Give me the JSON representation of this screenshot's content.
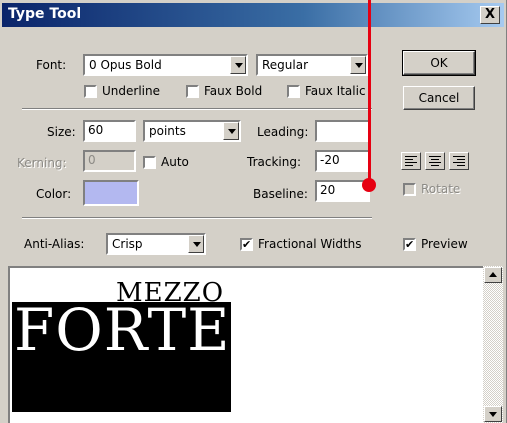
{
  "window": {
    "title": "Type Tool",
    "close_glyph": "X"
  },
  "font": {
    "label": "Font:",
    "family_value": "0 Opus Bold",
    "style_value": "Regular",
    "underline_label": "Underline",
    "underline_checked": false,
    "faux_bold_label": "Faux Bold",
    "faux_bold_checked": false,
    "faux_italic_label": "Faux Italic",
    "faux_italic_checked": false
  },
  "buttons": {
    "ok_label": "OK",
    "cancel_label": "Cancel"
  },
  "metrics": {
    "size_label": "Size:",
    "size_value": "60",
    "size_unit": "points",
    "leading_label": "Leading:",
    "leading_value": "",
    "kerning_label": "Kerning:",
    "kerning_value": "0",
    "auto_label": "Auto",
    "auto_checked": false,
    "tracking_label": "Tracking:",
    "tracking_value": "-20",
    "color_label": "Color:",
    "color_value": "#b3b8f0",
    "baseline_label": "Baseline:",
    "baseline_value": "20"
  },
  "alignment": {
    "left": "align-left-icon",
    "center": "align-center-icon",
    "right": "align-right-icon",
    "rotate_label": "Rotate",
    "rotate_checked": false
  },
  "options": {
    "antialias_label": "Anti-Alias:",
    "antialias_value": "Crisp",
    "fractional_label": "Fractional Widths",
    "fractional_checked": true,
    "preview_label": "Preview",
    "preview_checked": true,
    "check_glyph": "✔"
  },
  "preview": {
    "line1": "MEZZO",
    "line2": "FORTE"
  },
  "colors": {
    "titlebar_start": "#0a246a",
    "annotation_red": "#e60012"
  }
}
